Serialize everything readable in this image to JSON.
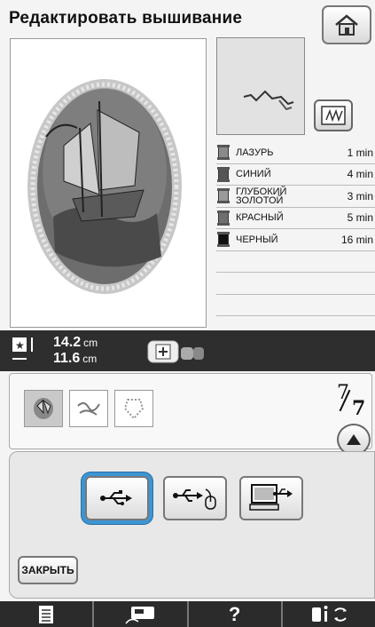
{
  "header": {
    "title": "Редактировать вышивание"
  },
  "icons": {
    "home": "home-icon",
    "mini_toggle": "stitch-view-icon",
    "size": "size-icon",
    "usb": "usb-icon",
    "usb_mouse": "usb-mouse-icon",
    "computer": "computer-icon",
    "up": "up-arrow-icon"
  },
  "threads": [
    {
      "name": "ЛАЗУРЬ",
      "time": "1 min",
      "color": "#8a8a8a"
    },
    {
      "name": "СИНИЙ",
      "time": "4 min",
      "color": "#555555"
    },
    {
      "name": "ГЛУБОКИЙ ЗОЛОТОЙ",
      "time": "3 min",
      "color": "#9a9a9a"
    },
    {
      "name": "КРАСНЫЙ",
      "time": "5 min",
      "color": "#6f6f6f"
    },
    {
      "name": "ЧЕРНЫЙ",
      "time": "16 min",
      "color": "#111111"
    }
  ],
  "size": {
    "width_value": "14.2",
    "height_value": "11.6",
    "unit": "cm"
  },
  "pages": {
    "current": "7",
    "total": "7"
  },
  "buttons": {
    "close": "ЗАКРЫТЬ"
  },
  "colors": {
    "active_outline": "#3d95d3",
    "bar": "#2e2e2e"
  }
}
